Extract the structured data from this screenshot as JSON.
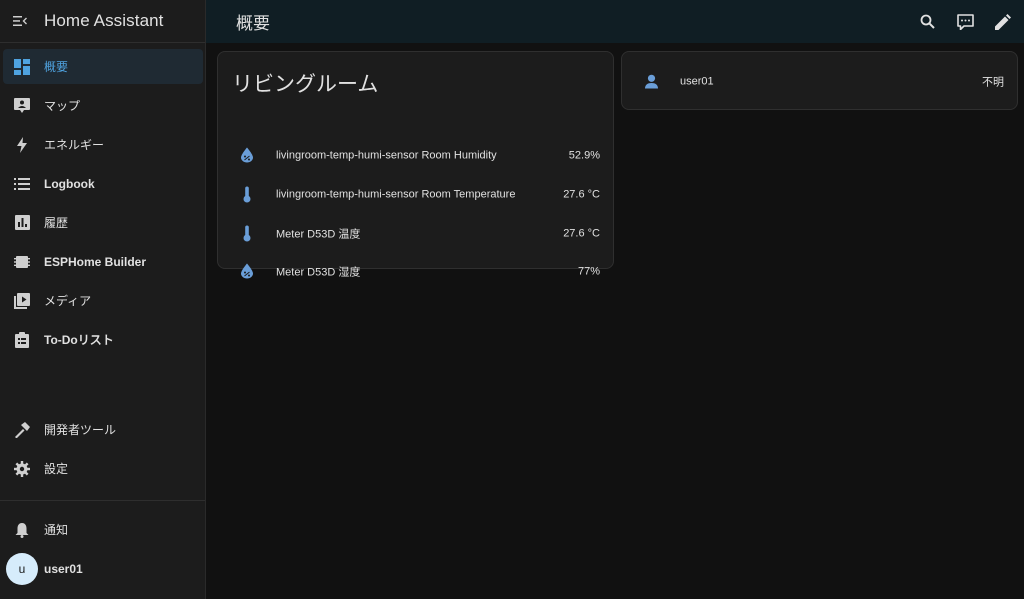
{
  "app": {
    "title": "Home Assistant"
  },
  "sidebar": {
    "items": [
      {
        "label": "概要",
        "icon": "dashboard-icon",
        "active": true
      },
      {
        "label": "マップ",
        "icon": "map-account-icon"
      },
      {
        "label": "エネルギー",
        "icon": "lightning-bolt-icon"
      },
      {
        "label": "Logbook",
        "icon": "format-list-icon"
      },
      {
        "label": "履歴",
        "icon": "chart-box-icon"
      },
      {
        "label": "ESPHome Builder",
        "icon": "chip-icon"
      },
      {
        "label": "メディア",
        "icon": "media-play-icon"
      },
      {
        "label": "To-Doリスト",
        "icon": "clipboard-list-icon"
      }
    ],
    "tools": [
      {
        "label": "開発者ツール",
        "icon": "hammer-icon"
      },
      {
        "label": "設定",
        "icon": "cog-icon"
      }
    ],
    "notifications_label": "通知",
    "user": {
      "initial": "u",
      "name": "user01"
    }
  },
  "header": {
    "title": "概要"
  },
  "colors": {
    "accent": "#4fa3e0",
    "icon_blue": "#6a9ed8",
    "topbar_bg": "#101e24"
  },
  "living_room_card": {
    "title": "リビングルーム",
    "entities": [
      {
        "name": "livingroom-temp-humi-sensor Room Humidity",
        "value": "52.9%",
        "icon": "water-percent-icon"
      },
      {
        "name": "livingroom-temp-humi-sensor Room Temperature",
        "value": "27.6 °C",
        "icon": "thermometer-icon"
      },
      {
        "name": "Meter D53D 温度",
        "value": "27.6 °C",
        "icon": "thermometer-icon"
      },
      {
        "name": "Meter D53D 湿度",
        "value": "77%",
        "icon": "water-percent-icon"
      }
    ]
  },
  "person_card": {
    "name": "user01",
    "state": "不明"
  }
}
